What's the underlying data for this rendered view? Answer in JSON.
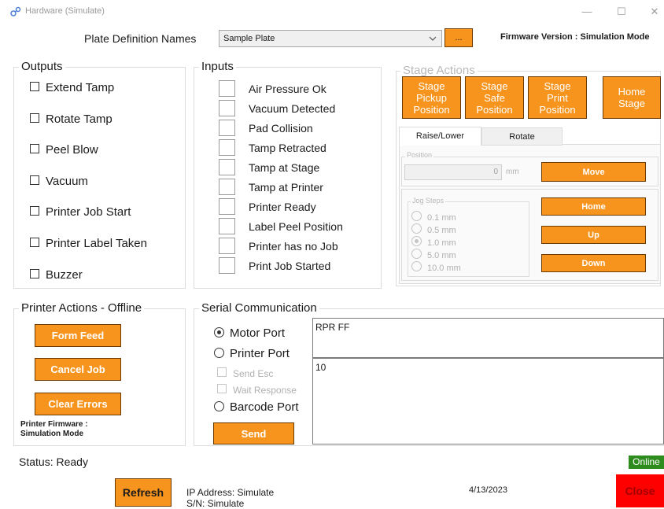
{
  "window": {
    "title": "Hardware (Simulate)",
    "minimize": "—",
    "maximize": "☐",
    "close": "✕"
  },
  "top": {
    "plate_label": "Plate Definition Names",
    "plate_value": "Sample Plate",
    "browse_label": "...",
    "firmware": "Firmware Version : Simulation Mode"
  },
  "outputs": {
    "title": "Outputs",
    "items": [
      "Extend Tamp",
      "Rotate Tamp",
      "Peel Blow",
      "Vacuum",
      "Printer Job Start",
      "Printer Label Taken",
      "Buzzer"
    ]
  },
  "inputs": {
    "title": "Inputs",
    "items": [
      "Air Pressure Ok",
      "Vacuum Detected",
      "Pad Collision",
      "Tamp Retracted",
      "Tamp at Stage",
      "Tamp at Printer",
      "Printer Ready",
      "Label Peel Position",
      "Printer has no Job",
      "Print Job Started"
    ]
  },
  "stage": {
    "title": "Stage Actions",
    "pickup": [
      "Stage",
      "Pickup",
      "Position"
    ],
    "safe": [
      "Stage",
      "Safe",
      "Position"
    ],
    "print": [
      "Stage",
      "Print",
      "Position"
    ],
    "home": [
      "Home",
      "Stage"
    ],
    "tabs": [
      "Raise/Lower",
      "Rotate"
    ],
    "position_title": "Position",
    "position_value": "0",
    "position_unit": "mm",
    "move": "Move",
    "jog_title": "Jog Steps",
    "jog_options": [
      "0.1 mm",
      "0.5 mm",
      "1.0 mm",
      "5.0 mm",
      "10.0 mm"
    ],
    "jog_selected_index": 2,
    "home_btn": "Home",
    "up_btn": "Up",
    "down_btn": "Down"
  },
  "printer_actions": {
    "title": "Printer Actions - Offline",
    "form_feed": "Form Feed",
    "cancel_job": "Cancel Job",
    "clear_errors": "Clear Errors",
    "fw_line1": "Printer Firmware :",
    "fw_line2": "Simulation Mode"
  },
  "serial": {
    "title": "Serial Communication",
    "motor_port": "Motor Port",
    "printer_port": "Printer Port",
    "send_esc": "Send Esc",
    "wait_response": "Wait Response",
    "barcode_port": "Barcode Port",
    "send": "Send",
    "output_text": "RPR FF",
    "input_text": "10"
  },
  "footer": {
    "status": "Status: Ready",
    "online": "Online",
    "refresh": "Refresh",
    "ip": "IP Address:  Simulate",
    "sn": "S/N: Simulate",
    "date": "4/13/2023",
    "close": "Close"
  },
  "colors": {
    "accent": "#f7941d",
    "online": "#2e8b1e",
    "close": "#ff0000"
  }
}
